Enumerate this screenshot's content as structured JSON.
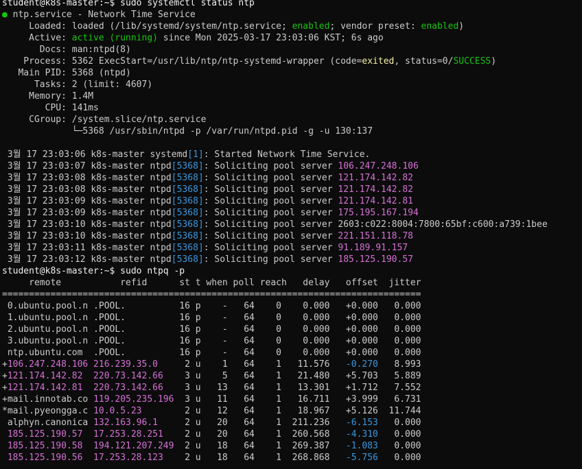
{
  "colors": {
    "background": "#0c0c0c",
    "foreground": "#cccccc",
    "green": "#16c60c",
    "yellow": "#f9f1a5",
    "magenta": "#d670d6",
    "cyan": "#3a96dd"
  },
  "lines": [
    [
      {
        "t": "student@k8s-master:~$ sudo systemctl status ntp",
        "c": "white"
      }
    ],
    [
      {
        "t": "●",
        "c": "green"
      },
      {
        "t": " ntp.service - Network Time Service"
      }
    ],
    [
      {
        "t": "     Loaded: loaded (/lib/systemd/system/ntp.service; "
      },
      {
        "t": "enabled",
        "c": "green"
      },
      {
        "t": "; vendor preset: "
      },
      {
        "t": "enabled",
        "c": "green"
      },
      {
        "t": ")"
      }
    ],
    [
      {
        "t": "     Active: "
      },
      {
        "t": "active (running)",
        "c": "green"
      },
      {
        "t": " since Mon 2025-03-17 23:03:06 KST; 6s ago"
      }
    ],
    [
      {
        "t": "       Docs: man:ntpd(8)"
      }
    ],
    [
      {
        "t": "    Process: 5362 ExecStart=/usr/lib/ntp/ntp-systemd-wrapper (code="
      },
      {
        "t": "exited",
        "c": "yellow"
      },
      {
        "t": ", status=0/"
      },
      {
        "t": "SUCCESS",
        "c": "green"
      },
      {
        "t": ")"
      }
    ],
    [
      {
        "t": "   Main PID: 5368 (ntpd)"
      }
    ],
    [
      {
        "t": "      Tasks: 2 (limit: 4607)"
      }
    ],
    [
      {
        "t": "     Memory: 1.4M"
      }
    ],
    [
      {
        "t": "        CPU: 141ms"
      }
    ],
    [
      {
        "t": "     CGroup: /system.slice/ntp.service"
      }
    ],
    [
      {
        "t": "             └─5368 /usr/sbin/ntpd -p /var/run/ntpd.pid -g -u 130:137"
      }
    ],
    [
      {
        "t": ""
      }
    ],
    [
      {
        "t": " 3월 17 23:03:06 k8s-master systemd"
      },
      {
        "t": "[1]",
        "c": "cyan"
      },
      {
        "t": ": Started Network Time Service."
      }
    ],
    [
      {
        "t": " 3월 17 23:03:07 k8s-master ntpd"
      },
      {
        "t": "[5368]",
        "c": "cyan"
      },
      {
        "t": ": Soliciting pool server "
      },
      {
        "t": "106.247.248.106",
        "c": "magenta"
      }
    ],
    [
      {
        "t": " 3월 17 23:03:08 k8s-master ntpd"
      },
      {
        "t": "[5368]",
        "c": "cyan"
      },
      {
        "t": ": Soliciting pool server "
      },
      {
        "t": "121.174.142.82",
        "c": "magenta"
      }
    ],
    [
      {
        "t": " 3월 17 23:03:08 k8s-master ntpd"
      },
      {
        "t": "[5368]",
        "c": "cyan"
      },
      {
        "t": ": Soliciting pool server "
      },
      {
        "t": "121.174.142.82",
        "c": "magenta"
      }
    ],
    [
      {
        "t": " 3월 17 23:03:09 k8s-master ntpd"
      },
      {
        "t": "[5368]",
        "c": "cyan"
      },
      {
        "t": ": Soliciting pool server "
      },
      {
        "t": "121.174.142.81",
        "c": "magenta"
      }
    ],
    [
      {
        "t": " 3월 17 23:03:09 k8s-master ntpd"
      },
      {
        "t": "[5368]",
        "c": "cyan"
      },
      {
        "t": ": Soliciting pool server "
      },
      {
        "t": "175.195.167.194",
        "c": "magenta"
      }
    ],
    [
      {
        "t": " 3월 17 23:03:10 k8s-master ntpd"
      },
      {
        "t": "[5368]",
        "c": "cyan"
      },
      {
        "t": ": Soliciting pool server 2603:c022:8004:7800:65bf:c600:a739:1bee"
      }
    ],
    [
      {
        "t": " 3월 17 23:03:10 k8s-master ntpd"
      },
      {
        "t": "[5368]",
        "c": "cyan"
      },
      {
        "t": ": Soliciting pool server "
      },
      {
        "t": "221.151.118.78",
        "c": "magenta"
      }
    ],
    [
      {
        "t": " 3월 17 23:03:11 k8s-master ntpd"
      },
      {
        "t": "[5368]",
        "c": "cyan"
      },
      {
        "t": ": Soliciting pool server "
      },
      {
        "t": "91.189.91.157",
        "c": "magenta"
      }
    ],
    [
      {
        "t": " 3월 17 23:03:12 k8s-master ntpd"
      },
      {
        "t": "[5368]",
        "c": "cyan"
      },
      {
        "t": ": Soliciting pool server "
      },
      {
        "t": "185.125.190.57",
        "c": "magenta"
      }
    ],
    [
      {
        "t": "student@k8s-master:~$ sudo ntpq -p",
        "c": "white"
      }
    ],
    [
      {
        "t": "     remote           refid      st t when poll reach   delay   offset  jitter"
      }
    ],
    [
      {
        "t": "=============================================================================="
      }
    ],
    [
      {
        "t": " 0.ubuntu.pool.n .POOL.          16 p    -   64    0    0.000   +0.000   0.000"
      }
    ],
    [
      {
        "t": " 1.ubuntu.pool.n .POOL.          16 p    -   64    0    0.000   +0.000   0.000"
      }
    ],
    [
      {
        "t": " 2.ubuntu.pool.n .POOL.          16 p    -   64    0    0.000   +0.000   0.000"
      }
    ],
    [
      {
        "t": " 3.ubuntu.pool.n .POOL.          16 p    -   64    0    0.000   +0.000   0.000"
      }
    ],
    [
      {
        "t": " ntp.ubuntu.com  .POOL.          16 p    -   64    0    0.000   +0.000   0.000"
      }
    ],
    [
      {
        "t": "+"
      },
      {
        "t": "106.247.248.106 216.239.35.0",
        "c": "magenta"
      },
      {
        "t": "     2 u    1   64    1   11.576   "
      },
      {
        "t": "-0.270",
        "c": "cyan"
      },
      {
        "t": "   8.993"
      }
    ],
    [
      {
        "t": "+"
      },
      {
        "t": "121.174.142.82  220.73.142.66",
        "c": "magenta"
      },
      {
        "t": "    3 u    5   64    1   21.480   +5.703   5.889"
      }
    ],
    [
      {
        "t": "+"
      },
      {
        "t": "121.174.142.81  220.73.142.66",
        "c": "magenta"
      },
      {
        "t": "    3 u   13   64    1   13.301   +1.712   7.552"
      }
    ],
    [
      {
        "t": "+mail.innotab.co "
      },
      {
        "t": "119.205.235.196",
        "c": "magenta"
      },
      {
        "t": "  3 u   11   64    1   16.711   +3.999   6.731"
      }
    ],
    [
      {
        "t": "*mail.pyeongga.c "
      },
      {
        "t": "10.0.5.23",
        "c": "magenta"
      },
      {
        "t": "        2 u   12   64    1   18.967   +5.126  11.744"
      }
    ],
    [
      {
        "t": " alphyn.canonica "
      },
      {
        "t": "132.163.96.1",
        "c": "magenta"
      },
      {
        "t": "     2 u   20   64    1  211.236   "
      },
      {
        "t": "-6.153",
        "c": "cyan"
      },
      {
        "t": "   0.000"
      }
    ],
    [
      {
        "t": " "
      },
      {
        "t": "185.125.190.57  17.253.28.251",
        "c": "magenta"
      },
      {
        "t": "    2 u   20   64    1  260.568   "
      },
      {
        "t": "-4.310",
        "c": "cyan"
      },
      {
        "t": "   0.000"
      }
    ],
    [
      {
        "t": " "
      },
      {
        "t": "185.125.190.58  194.121.207.249",
        "c": "magenta"
      },
      {
        "t": "  2 u   18   64    1  269.387   "
      },
      {
        "t": "-1.083",
        "c": "cyan"
      },
      {
        "t": "   0.000"
      }
    ],
    [
      {
        "t": " "
      },
      {
        "t": "185.125.190.56  17.253.28.123",
        "c": "magenta"
      },
      {
        "t": "    2 u   18   64    1  268.868   "
      },
      {
        "t": "-5.756",
        "c": "cyan"
      },
      {
        "t": "   0.000"
      }
    ]
  ]
}
